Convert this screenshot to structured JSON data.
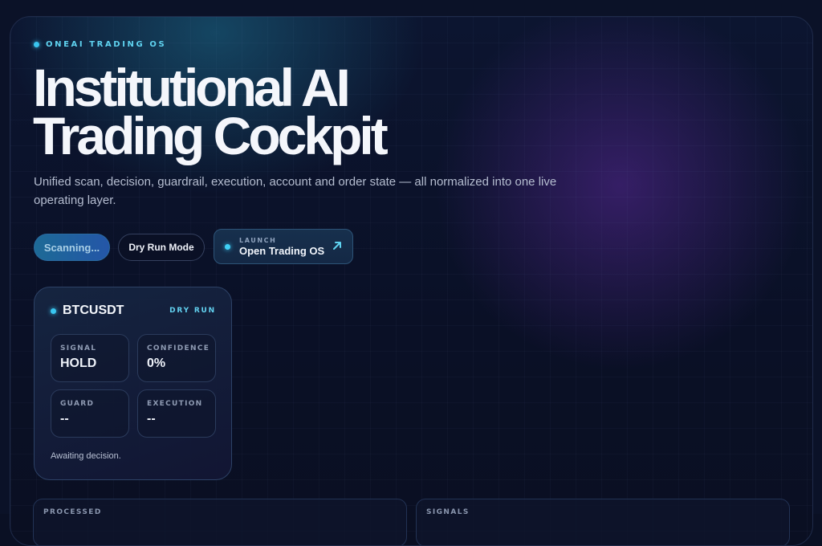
{
  "brand": {
    "eyebrow": "ONEAI TRADING OS"
  },
  "hero": {
    "headline": "Institutional AI Trading Cockpit",
    "subtitle": "Unified scan, decision, guardrail, execution, account and order state — all normalized into one live operating layer."
  },
  "actions": {
    "scan_label": "Scanning...",
    "dry_run_label": "Dry Run Mode",
    "launch_eyebrow": "LAUNCH",
    "launch_label": "Open Trading OS"
  },
  "ticker_card": {
    "symbol": "BTCUSDT",
    "mode": "DRY RUN",
    "stats": [
      {
        "label": "SIGNAL",
        "value": "HOLD"
      },
      {
        "label": "CONFIDENCE",
        "value": "0%"
      },
      {
        "label": "GUARD",
        "value": "--"
      },
      {
        "label": "EXECUTION",
        "value": "--"
      }
    ],
    "status": "Awaiting decision."
  },
  "panels": [
    {
      "label": "PROCESSED"
    },
    {
      "label": "SIGNALS"
    }
  ],
  "colors": {
    "accent": "#39c6f0",
    "background": "#0b1228",
    "violet_glow": "#5828a0"
  },
  "icons": {
    "status_dot": "dot-icon",
    "launch_arrow": "arrow-up-right-icon"
  }
}
